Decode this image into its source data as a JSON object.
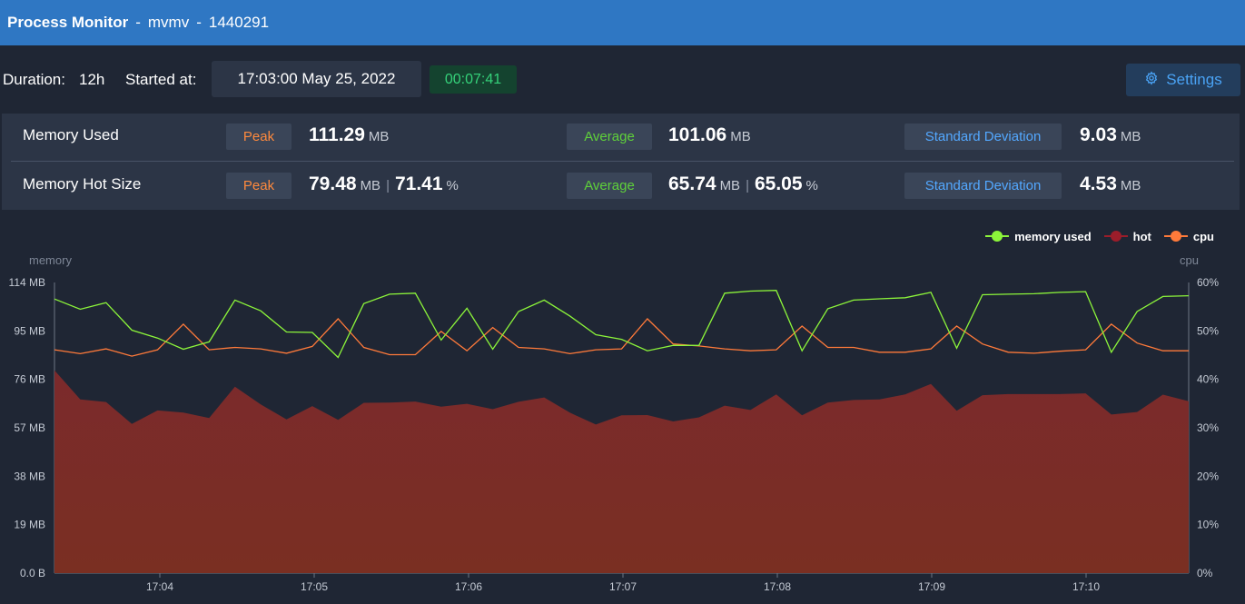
{
  "titlebar": {
    "app": "Process Monitor",
    "sep1": "-",
    "user": "mvmv",
    "sep2": "-",
    "pid": "1440291"
  },
  "info": {
    "duration_label": "Duration:",
    "duration_value": "12h",
    "started_label": "Started at:",
    "started_value": "17:03:00 May 25, 2022",
    "elapsed": "00:07:41",
    "settings_label": "Settings"
  },
  "stats": {
    "memory_used": {
      "label": "Memory Used",
      "peak_label": "Peak",
      "peak_value": "111.29",
      "peak_unit": "MB",
      "avg_label": "Average",
      "avg_value": "101.06",
      "avg_unit": "MB",
      "std_label": "Standard Deviation",
      "std_value": "9.03",
      "std_unit": "MB"
    },
    "memory_hot": {
      "label": "Memory Hot Size",
      "peak_label": "Peak",
      "peak_value": "79.48",
      "peak_unit": "MB",
      "peak_sep": "|",
      "peak_pct": "71.41",
      "peak_pct_unit": "%",
      "avg_label": "Average",
      "avg_value": "65.74",
      "avg_unit": "MB",
      "avg_sep": "|",
      "avg_pct": "65.05",
      "avg_pct_unit": "%",
      "std_label": "Standard Deviation",
      "std_value": "4.53",
      "std_unit": "MB"
    }
  },
  "colors": {
    "memory_used": "#8cf53a",
    "hot": "#9b1d2a",
    "cpu": "#ff7a3a",
    "hot_fill": "#7a2a2b"
  },
  "chart_data": {
    "type": "line",
    "y_left_title": "memory",
    "y_right_title": "cpu",
    "y_left_ticks": [
      "114 MB",
      "95 MB",
      "76 MB",
      "57 MB",
      "38 MB",
      "19 MB",
      "0.0 B"
    ],
    "y_left_range": [
      0,
      114
    ],
    "y_right_ticks": [
      "60%",
      "50%",
      "40%",
      "30%",
      "20%",
      "10%",
      "0%"
    ],
    "y_right_range": [
      0,
      60
    ],
    "x_ticks": [
      "17:04",
      "17:05",
      "17:06",
      "17:07",
      "17:08",
      "17:09",
      "17:10"
    ],
    "legend": [
      "memory used",
      "hot",
      "cpu"
    ],
    "series": [
      {
        "name": "memory used",
        "values": [
          107.5,
          103.5,
          106.1,
          95.3,
          92.2,
          87.8,
          90.7,
          107.1,
          102.9,
          94.6,
          94.4,
          84.6,
          105.7,
          109.4,
          109.8,
          91.4,
          103.9,
          87.8,
          102.6,
          107.1,
          100.8,
          93.5,
          91.7,
          87.2,
          89.3,
          89.3,
          109.8,
          110.6,
          110.9,
          87.2,
          103.7,
          107.1,
          107.6,
          108.0,
          110.1,
          88.2,
          109.2,
          109.4,
          109.6,
          110.1,
          110.4,
          86.6,
          102.6,
          108.5,
          108.8
        ]
      },
      {
        "name": "hot",
        "values": [
          79.5,
          68.1,
          67.1,
          58.5,
          63.8,
          63.0,
          60.8,
          73.1,
          66.2,
          60.3,
          65.5,
          60.1,
          66.8,
          66.9,
          67.3,
          65.3,
          66.4,
          64.3,
          67.2,
          68.9,
          62.9,
          58.3,
          61.9,
          62.0,
          59.5,
          61.1,
          65.7,
          64.0,
          70.1,
          61.9,
          66.9,
          67.9,
          68.1,
          70.1,
          74.2,
          63.7,
          69.8,
          70.2,
          70.2,
          70.2,
          70.5,
          62.2,
          63.2,
          70.0,
          67.4
        ]
      },
      {
        "name": "cpu",
        "values": [
          46.1,
          45.3,
          46.3,
          44.8,
          46.1,
          51.4,
          46.1,
          46.6,
          46.3,
          45.4,
          46.8,
          52.5,
          46.6,
          45.1,
          45.1,
          49.9,
          45.9,
          50.7,
          46.6,
          46.3,
          45.3,
          46.1,
          46.3,
          52.5,
          47.3,
          46.9,
          46.3,
          45.9,
          46.1,
          51.0,
          46.6,
          46.6,
          45.6,
          45.6,
          46.3,
          51.0,
          47.3,
          45.6,
          45.4,
          45.8,
          46.1,
          51.4,
          47.5,
          45.9,
          45.9
        ]
      }
    ]
  }
}
